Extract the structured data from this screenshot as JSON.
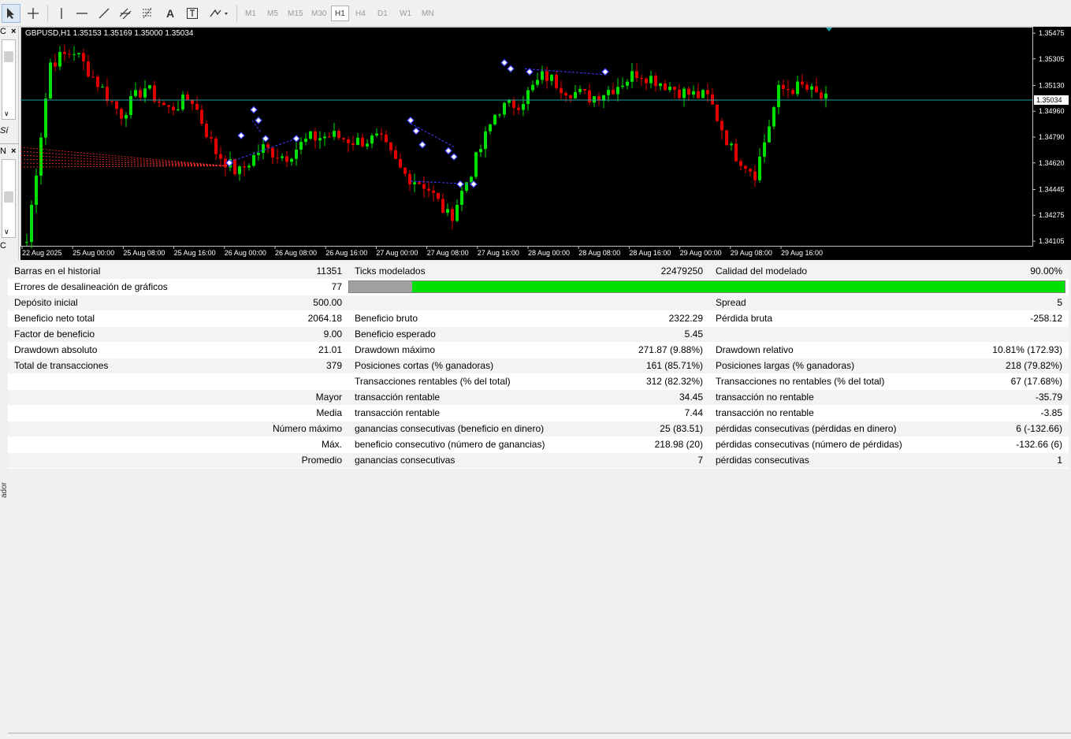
{
  "toolbar": {
    "timeframes": [
      "M1",
      "M5",
      "M15",
      "M30",
      "H1",
      "H4",
      "D1",
      "W1",
      "MN"
    ],
    "active_timeframe": "H1",
    "tools": [
      "cursor-icon",
      "crosshair-icon",
      "vertical-line-icon",
      "horizontal-line-icon",
      "trend-line-icon",
      "equidistant-channel-icon",
      "fibonacci-icon",
      "text-icon",
      "text-label-icon",
      "arrows-icon"
    ]
  },
  "left_panel": {
    "top_label": "C",
    "close": "×",
    "mid_label": "Sí",
    "lower_label": "N",
    "bottom_label": "C",
    "vertical_label": "ador"
  },
  "chart": {
    "header": "GBPUSD,H1  1.35153 1.35169 1.35000 1.35034",
    "current_price": "1.35034",
    "price_ticks": [
      "1.35475",
      "1.35305",
      "1.35130",
      "1.34960",
      "1.34790",
      "1.34620",
      "1.34445",
      "1.34275",
      "1.34105"
    ],
    "time_ticks": [
      "22 Aug 2025",
      "25 Aug 00:00",
      "25 Aug 08:00",
      "25 Aug 16:00",
      "26 Aug 00:00",
      "26 Aug 08:00",
      "26 Aug 16:00",
      "27 Aug 00:00",
      "27 Aug 08:00",
      "27 Aug 16:00",
      "28 Aug 00:00",
      "28 Aug 08:00",
      "28 Aug 16:00",
      "29 Aug 00:00",
      "29 Aug 08:00",
      "29 Aug 16:00"
    ],
    "colors": {
      "background": "#000000",
      "bull": "#00e000",
      "bear": "#e00000",
      "price_line": "#20a0a0",
      "markers": "#3c3cff"
    }
  },
  "chart_data": {
    "type": "candlestick",
    "symbol": "GBPUSD",
    "timeframe": "H1",
    "ylim": [
      1.34105,
      1.35475
    ],
    "x": [
      "22 Aug 2025",
      "25 Aug 00:00",
      "25 Aug 08:00",
      "25 Aug 16:00",
      "26 Aug 00:00",
      "26 Aug 08:00",
      "26 Aug 16:00",
      "27 Aug 00:00",
      "27 Aug 08:00",
      "27 Aug 16:00",
      "28 Aug 00:00",
      "28 Aug 08:00",
      "28 Aug 16:00",
      "29 Aug 00:00",
      "29 Aug 08:00",
      "29 Aug 16:00"
    ],
    "close_path": [
      1.341,
      1.3528,
      1.3536,
      1.3515,
      1.3494,
      1.3512,
      1.3497,
      1.3505,
      1.347,
      1.3455,
      1.3472,
      1.3466,
      1.3478,
      1.348,
      1.3476,
      1.3478,
      1.3455,
      1.3447,
      1.3425,
      1.346,
      1.3497,
      1.3502,
      1.352,
      1.351,
      1.3505,
      1.3512,
      1.3522,
      1.3515,
      1.3508,
      1.3505,
      1.347,
      1.3455,
      1.351,
      1.3512,
      1.3503
    ],
    "last": {
      "open": 1.35153,
      "high": 1.35169,
      "low": 1.35,
      "close": 1.35034
    }
  },
  "report": {
    "rows": [
      [
        "Barras en el historial",
        "11351",
        "Ticks modelados",
        "22479250",
        "Calidad del modelado",
        "90.00%"
      ],
      [
        "Errores de desalineación de gráficos",
        "77",
        "",
        "",
        "",
        ""
      ],
      [
        "Depósito inicial",
        "500.00",
        "",
        "",
        "Spread",
        "5"
      ],
      [
        "Beneficio neto total",
        "2064.18",
        "Beneficio bruto",
        "2322.29",
        "Pérdida bruta",
        "-258.12"
      ],
      [
        "Factor de beneficio",
        "9.00",
        "Beneficio esperado",
        "5.45",
        "",
        ""
      ],
      [
        "Drawdown absoluto",
        "21.01",
        "Drawdown máximo",
        "271.87 (9.88%)",
        "Drawdown relativo",
        "10.81% (172.93)"
      ],
      [
        "Total de transacciones",
        "379",
        "Posiciones cortas (% ganadoras)",
        "161 (85.71%)",
        "Posiciones largas (% ganadoras)",
        "218 (79.82%)"
      ],
      [
        "",
        "",
        "Transacciones rentables (% del total)",
        "312 (82.32%)",
        "Transacciones no rentables (% del total)",
        "67 (17.68%)"
      ],
      [
        "",
        "Mayor",
        "transacción rentable",
        "34.45",
        "transacción no rentable",
        "-35.79"
      ],
      [
        "",
        "Media",
        "transacción rentable",
        "7.44",
        "transacción no rentable",
        "-3.85"
      ],
      [
        "",
        "Número máximo",
        "ganancias consecutivas (beneficio en dinero)",
        "25 (83.51)",
        "pérdidas consecutivas (pérdidas en dinero)",
        "6 (-132.66)"
      ],
      [
        "",
        "Máx.",
        "beneficio consecutivo (número de ganancias)",
        "218.98 (20)",
        "pérdidas consecutivas (número de pérdidas)",
        "-132.66 (6)"
      ],
      [
        "",
        "Promedio",
        "ganancias consecutivas",
        "7",
        "pérdidas consecutivas",
        "1"
      ]
    ],
    "quality_fraction": 0.9,
    "mismatch_grey_fraction": 0.088
  }
}
